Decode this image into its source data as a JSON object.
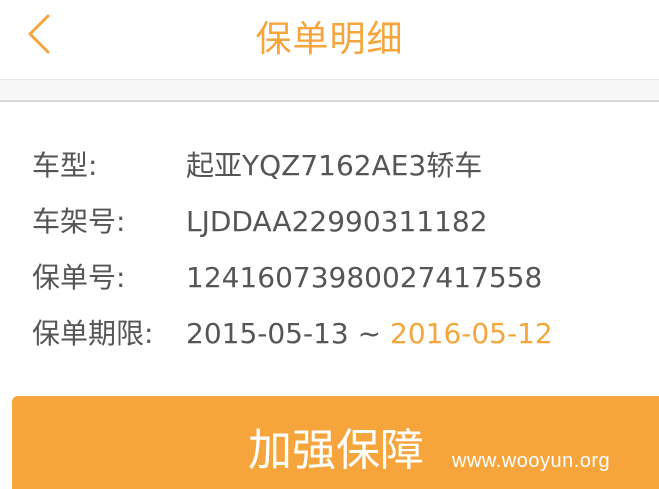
{
  "header": {
    "title": "保单明细",
    "back_icon": "chevron-left-icon"
  },
  "policy": {
    "rows": [
      {
        "label": "车型:",
        "value": "起亚YQZ7162AE3轿车"
      },
      {
        "label": "车架号:",
        "value": "LJDDAA22990311182"
      },
      {
        "label": "保单号:",
        "value": "12416073980027417558"
      }
    ],
    "period": {
      "label": "保单期限:",
      "start": "2015-05-13",
      "separator": " ~ ",
      "end": "2016-05-12"
    }
  },
  "action": {
    "label": "加强保障"
  },
  "watermark": "www.wooyun.org",
  "colors": {
    "accent": "#f5a53c",
    "text": "#555555"
  }
}
